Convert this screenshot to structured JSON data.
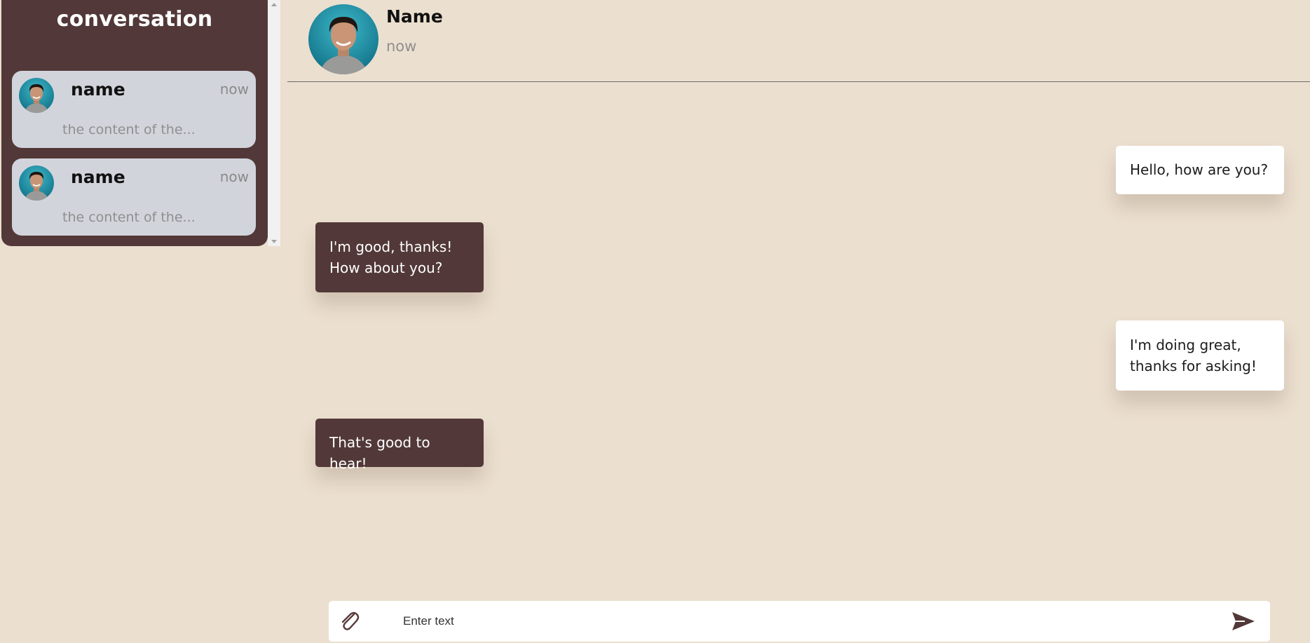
{
  "sidebar": {
    "title": "conversation",
    "conversations": [
      {
        "name": "name",
        "time": "now",
        "preview": "the content of the..."
      },
      {
        "name": "name",
        "time": "now",
        "preview": "the content of the..."
      }
    ]
  },
  "chat": {
    "contact_name": "Name",
    "status": "now",
    "messages": [
      {
        "direction": "sent",
        "text": "Hello, how are you?"
      },
      {
        "direction": "received",
        "text": "I'm good, thanks! How about you?"
      },
      {
        "direction": "sent",
        "text": "I'm doing great, thanks for asking!"
      },
      {
        "direction": "received",
        "text": "That's good to hear!"
      }
    ]
  },
  "composer": {
    "placeholder": "Enter text",
    "value": ""
  },
  "icons": {
    "attach": "paperclip-icon",
    "send": "send-icon"
  },
  "colors": {
    "background": "#ebdfcf",
    "sidebar": "#523838",
    "conversation_card": "#d2d4dc",
    "received_bubble": "#523838",
    "sent_bubble": "#ffffff"
  }
}
